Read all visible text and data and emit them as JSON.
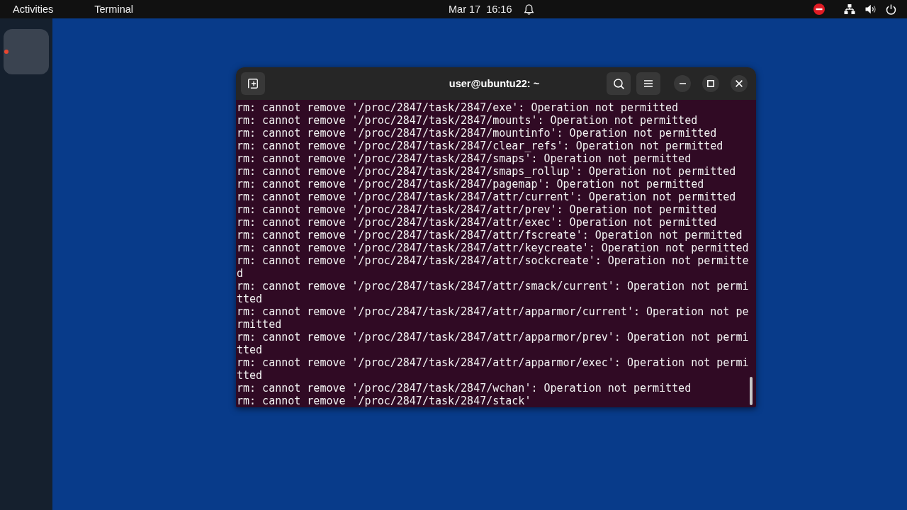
{
  "top_bar": {
    "activities": "Activities",
    "app_menu": "Terminal",
    "clock": "Mar 17  16:16"
  },
  "dock": {
    "items": [
      {
        "running": true
      }
    ]
  },
  "terminal": {
    "title": "user@ubuntu22: ~",
    "lines": [
      "rm: cannot remove '/proc/2847/task/2847/exe': Operation not permitted",
      "rm: cannot remove '/proc/2847/task/2847/mounts': Operation not permitted",
      "rm: cannot remove '/proc/2847/task/2847/mountinfo': Operation not permitted",
      "rm: cannot remove '/proc/2847/task/2847/clear_refs': Operation not permitted",
      "rm: cannot remove '/proc/2847/task/2847/smaps': Operation not permitted",
      "rm: cannot remove '/proc/2847/task/2847/smaps_rollup': Operation not permitted",
      "rm: cannot remove '/proc/2847/task/2847/pagemap': Operation not permitted",
      "rm: cannot remove '/proc/2847/task/2847/attr/current': Operation not permitted",
      "rm: cannot remove '/proc/2847/task/2847/attr/prev': Operation not permitted",
      "rm: cannot remove '/proc/2847/task/2847/attr/exec': Operation not permitted",
      "rm: cannot remove '/proc/2847/task/2847/attr/fscreate': Operation not permitted",
      "rm: cannot remove '/proc/2847/task/2847/attr/keycreate': Operation not permitted",
      "rm: cannot remove '/proc/2847/task/2847/attr/sockcreate': Operation not permitted",
      "rm: cannot remove '/proc/2847/task/2847/attr/smack/current': Operation not permitted",
      "rm: cannot remove '/proc/2847/task/2847/attr/apparmor/current': Operation not permitted",
      "rm: cannot remove '/proc/2847/task/2847/attr/apparmor/prev': Operation not permitted",
      "rm: cannot remove '/proc/2847/task/2847/attr/apparmor/exec': Operation not permitted",
      "rm: cannot remove '/proc/2847/task/2847/wchan': Operation not permitted",
      "rm: cannot remove '/proc/2847/task/2847/stack'"
    ]
  }
}
